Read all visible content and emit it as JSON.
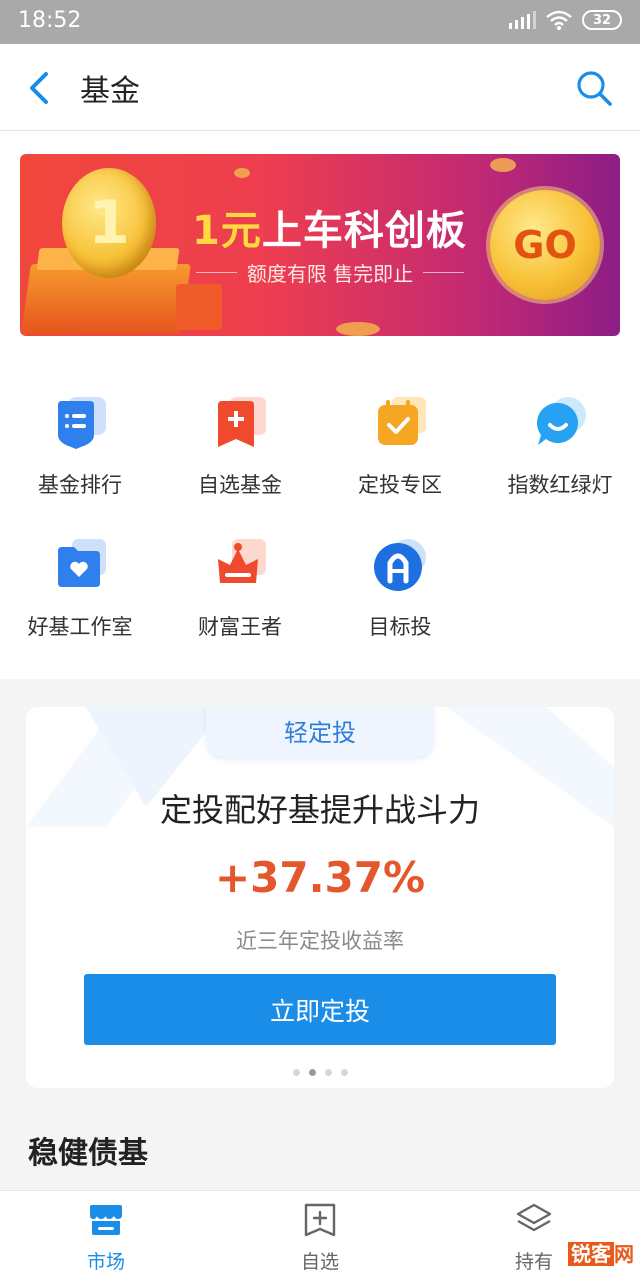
{
  "status_bar": {
    "time": "18:52",
    "battery": "32",
    "icons": [
      "signal-icon",
      "wifi-icon",
      "battery-icon"
    ]
  },
  "nav": {
    "title": "基金",
    "back_icon": "chevron-left-icon",
    "search_icon": "search-icon"
  },
  "banner": {
    "coin_text": "1",
    "title_highlight": "1元",
    "title_rest": "上车科创板",
    "subtitle": "额度有限 售完即止",
    "go_text": "GO"
  },
  "grid": [
    {
      "label": "基金排行",
      "icon": "list-icon",
      "color": "#2f80ed"
    },
    {
      "label": "自选基金",
      "icon": "bookmark-plus-icon",
      "color": "#f04a2e"
    },
    {
      "label": "定投专区",
      "icon": "calendar-check-icon",
      "color": "#f5a623"
    },
    {
      "label": "指数红绿灯",
      "icon": "chat-bubble-icon",
      "color": "#27a2f3"
    },
    {
      "label": "好基工作室",
      "icon": "folder-heart-icon",
      "color": "#2f80ed"
    },
    {
      "label": "财富王者",
      "icon": "crown-icon",
      "color": "#f04a2e"
    },
    {
      "label": "目标投",
      "icon": "target-a-icon",
      "color": "#1e6fe0"
    }
  ],
  "card": {
    "tab_label": "轻定投",
    "headline": "定投配好基提升战斗力",
    "rate": "+37.37%",
    "rate_desc": "近三年定投收益率",
    "button_label": "立即定投",
    "page_count": 4,
    "active_page": 1
  },
  "section_title": "稳健债基",
  "tab_bar": [
    {
      "label": "市场",
      "icon": "store-icon",
      "active": true
    },
    {
      "label": "自选",
      "icon": "bookmark-plus-icon",
      "active": false
    },
    {
      "label": "持有",
      "icon": "layers-icon",
      "active": false
    }
  ],
  "watermark": {
    "a": "锐客",
    "b": "网"
  },
  "colors": {
    "accent": "#1a8de8",
    "rate": "#e4572d",
    "status_bar": "#a9a9a9"
  }
}
